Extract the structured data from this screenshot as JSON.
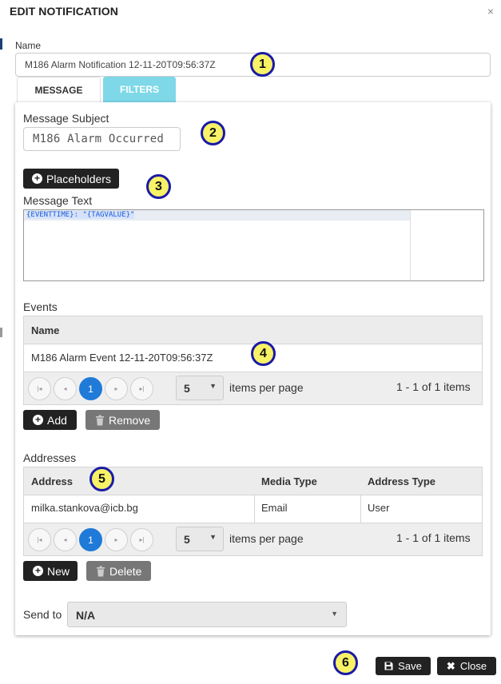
{
  "dialog": {
    "title": "EDIT NOTIFICATION",
    "close_glyph": "×"
  },
  "name": {
    "label": "Name",
    "value": "M186 Alarm Notification 12-11-20T09:56:37Z"
  },
  "tabs": [
    {
      "label": "MESSAGE",
      "active": true
    },
    {
      "label": "FILTERS",
      "active": false
    }
  ],
  "message": {
    "subject_label": "Message Subject",
    "subject_value": "M186 Alarm Occurred",
    "placeholders_button": "Placeholders",
    "text_label": "Message Text",
    "text_value": "{EVENTTIME}: \"{TAGVALUE}\""
  },
  "events": {
    "label": "Events",
    "columns": [
      "Name"
    ],
    "rows": [
      [
        "M186 Alarm Event 12-11-20T09:56:37Z"
      ]
    ],
    "pager": {
      "first": "|◂",
      "prev": "◂",
      "page": "1",
      "next": "▸",
      "last": "▸|",
      "page_size": "5",
      "items_per_page": "items per page",
      "info": "1 - 1 of 1 items"
    },
    "add_button": "Add",
    "remove_button": "Remove"
  },
  "addresses": {
    "label": "Addresses",
    "columns": [
      "Address",
      "Media Type",
      "Address Type"
    ],
    "rows": [
      [
        "milka.stankova@icb.bg",
        "Email",
        "User"
      ]
    ],
    "pager": {
      "first": "|◂",
      "prev": "◂",
      "page": "1",
      "next": "▸",
      "last": "▸|",
      "page_size": "5",
      "items_per_page": "items per page",
      "info": "1 - 1 of 1 items"
    },
    "new_button": "New",
    "delete_button": "Delete"
  },
  "send_to": {
    "label": "Send to",
    "value": "N/A",
    "caret": "▼"
  },
  "footer": {
    "save_button": "Save",
    "close_button": "Close"
  },
  "callouts": [
    "1",
    "2",
    "3",
    "4",
    "5",
    "6"
  ],
  "colors": {
    "filters_tab": "#7ed8e8",
    "page_active": "#1f7ad8",
    "callout_fill": "#f7f266",
    "callout_border": "#1a1aa6"
  }
}
